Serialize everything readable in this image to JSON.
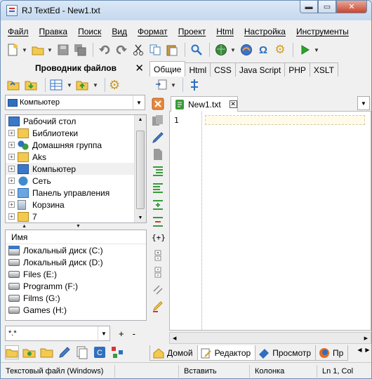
{
  "window": {
    "title": "RJ TextEd - New1.txt",
    "min_glyph": "▬",
    "max_glyph": "▭",
    "close_glyph": "✕"
  },
  "menu": [
    "Файл",
    "Правка",
    "Поиск",
    "Вид",
    "Формат",
    "Проект",
    "Html",
    "Настройка",
    "Инструменты"
  ],
  "explorer": {
    "title": "Проводник файлов",
    "close_glyph": "✕",
    "location": "Компьютер",
    "tree": [
      {
        "label": "Рабочий стол",
        "icon": "desktop-icon"
      },
      {
        "label": "Библиотеки",
        "icon": "libraries-icon"
      },
      {
        "label": "Домашняя группа",
        "icon": "homegroup-icon"
      },
      {
        "label": "Aks",
        "icon": "user-folder-icon"
      },
      {
        "label": "Компьютер",
        "icon": "computer-icon"
      },
      {
        "label": "Сеть",
        "icon": "network-icon"
      },
      {
        "label": "Панель управления",
        "icon": "control-panel-icon"
      },
      {
        "label": "Корзина",
        "icon": "recycle-bin-icon"
      },
      {
        "label": "7",
        "icon": "folder-icon"
      }
    ],
    "files_header": "Имя",
    "files": [
      "Локальный диск (C:)",
      "Локальный диск (D:)",
      "Files (E:)",
      "Programm (F:)",
      "Films (G:)",
      "Games (H:)"
    ],
    "filter_value": "*.*",
    "filter_add": "+",
    "filter_remove": "-"
  },
  "doc_tabs": [
    "Общие",
    "Html",
    "CSS",
    "Java Script",
    "PHP",
    "XSLT"
  ],
  "editor": {
    "tab_label": "New1.txt",
    "tab_close": "✕",
    "line_number": "1"
  },
  "bottom_tabs": [
    "Домой",
    "Редактор",
    "Просмотр",
    "Пр"
  ],
  "status": {
    "file_type": "Текстовый файл (Windows)",
    "insert_mode": "Вставить",
    "column_label": "Колонка",
    "position": "Ln 1, Col"
  },
  "colors": {
    "accent": "#2f6fbf",
    "title_bar": "#c4d8ee",
    "close": "#c7462f"
  }
}
